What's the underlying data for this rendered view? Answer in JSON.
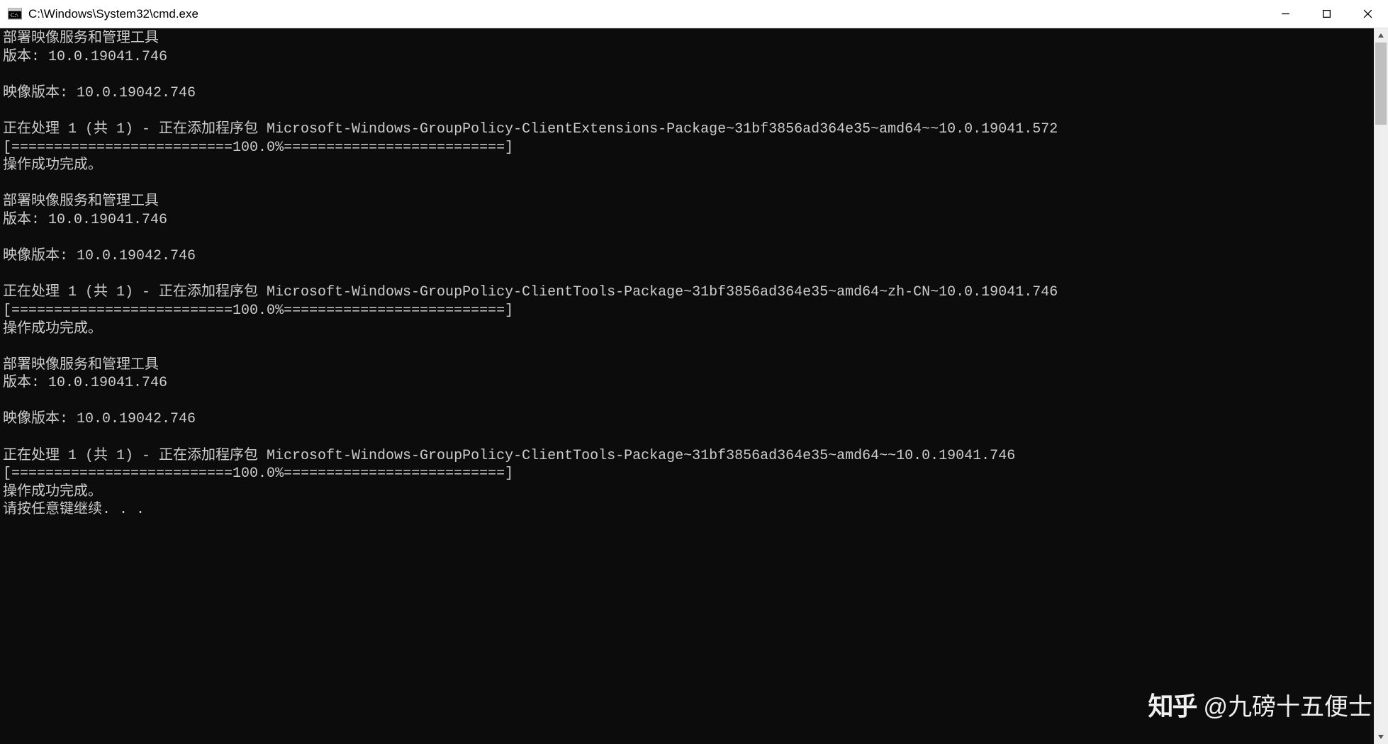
{
  "window": {
    "title": "C:\\Windows\\System32\\cmd.exe"
  },
  "scrollbar": {
    "thumb_top_pct": 0,
    "thumb_height_pct": 12
  },
  "watermark": {
    "logo": "知乎",
    "text": "@九磅十五便士"
  },
  "terminal_lines": [
    "部署映像服务和管理工具",
    "版本: 10.0.19041.746",
    "",
    "映像版本: 10.0.19042.746",
    "",
    "正在处理 1 (共 1) - 正在添加程序包 Microsoft-Windows-GroupPolicy-ClientExtensions-Package~31bf3856ad364e35~amd64~~10.0.19041.572",
    "[==========================100.0%==========================]",
    "操作成功完成。",
    "",
    "部署映像服务和管理工具",
    "版本: 10.0.19041.746",
    "",
    "映像版本: 10.0.19042.746",
    "",
    "正在处理 1 (共 1) - 正在添加程序包 Microsoft-Windows-GroupPolicy-ClientTools-Package~31bf3856ad364e35~amd64~zh-CN~10.0.19041.746",
    "[==========================100.0%==========================]",
    "操作成功完成。",
    "",
    "部署映像服务和管理工具",
    "版本: 10.0.19041.746",
    "",
    "映像版本: 10.0.19042.746",
    "",
    "正在处理 1 (共 1) - 正在添加程序包 Microsoft-Windows-GroupPolicy-ClientTools-Package~31bf3856ad364e35~amd64~~10.0.19041.746",
    "[==========================100.0%==========================]",
    "操作成功完成。",
    "请按任意键继续. . ."
  ]
}
